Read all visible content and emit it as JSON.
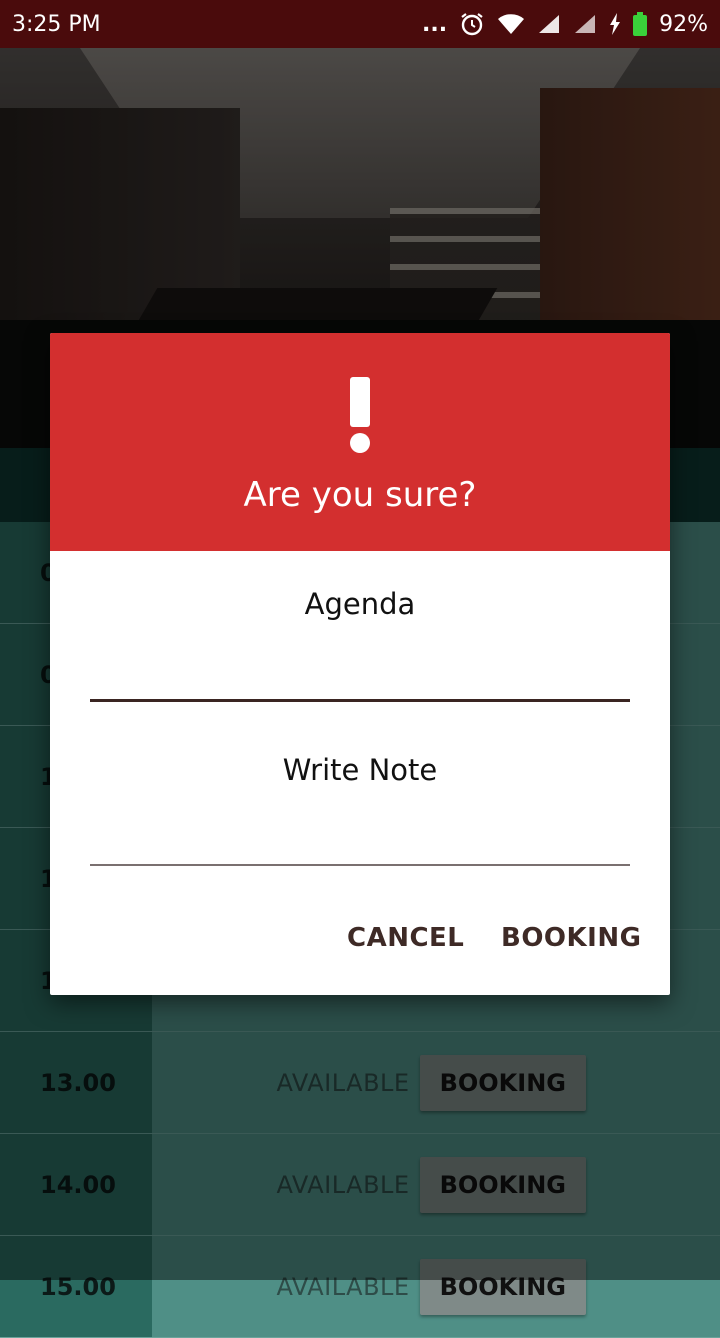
{
  "status_bar": {
    "time": "3:25 PM",
    "overflow": "...",
    "battery": "92%",
    "icons": [
      "alarm-icon",
      "wifi-icon",
      "signal-icon",
      "signal-icon",
      "charging-icon",
      "battery-icon"
    ]
  },
  "schedule": {
    "rows": [
      {
        "time": "13.00",
        "status": "AVAILABLE",
        "action": "BOOKING"
      },
      {
        "time": "14.00",
        "status": "AVAILABLE",
        "action": "BOOKING"
      }
    ]
  },
  "dialog": {
    "title": "Are you sure?",
    "agenda_label": "Agenda",
    "note_label": "Write Note",
    "cancel_label": "CANCEL",
    "confirm_label": "BOOKING",
    "colors": {
      "header": "#d32f2f",
      "action_text": "#3e2a26"
    }
  }
}
